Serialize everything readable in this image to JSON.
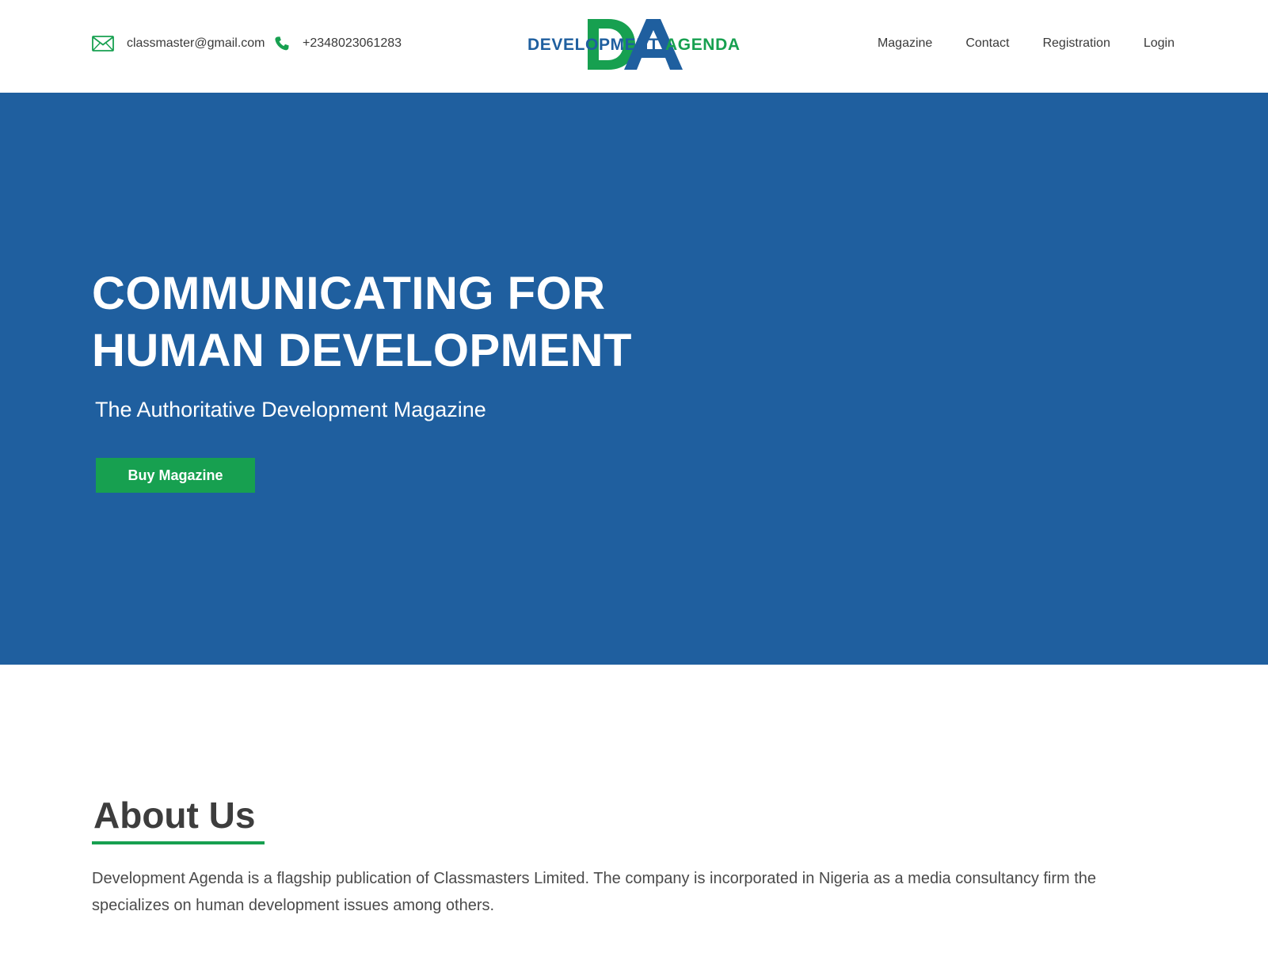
{
  "header": {
    "email": "classmaster@gmail.com",
    "phone": "+2348023061283",
    "logo": {
      "text_left": "DEVELOPMENT",
      "text_right": "AGENDA",
      "monogram": "DA",
      "colors": {
        "blue": "#1f5f9f",
        "green": "#17a050"
      }
    },
    "nav": [
      "Magazine",
      "Contact",
      "Registration",
      "Login"
    ]
  },
  "hero": {
    "title_line1": "COMMUNICATING FOR",
    "title_line2": "HUMAN DEVELOPMENT",
    "subtitle": "The Authoritative Development Magazine",
    "button_label": "Buy Magazine",
    "background": "#1f5f9f"
  },
  "about": {
    "title": "About Us",
    "paragraph": "Development Agenda is a flagship publication of Classmasters Limited. The company is incorporated in Nigeria as a media consultancy firm the specializes on human development issues among others.",
    "paragraph_2": ""
  },
  "colors": {
    "accent_green": "#17a050",
    "brand_blue": "#1f5f9f",
    "text_dark": "#3d3d3d"
  },
  "icons": {
    "email": "envelope-icon",
    "phone": "phone-icon"
  }
}
